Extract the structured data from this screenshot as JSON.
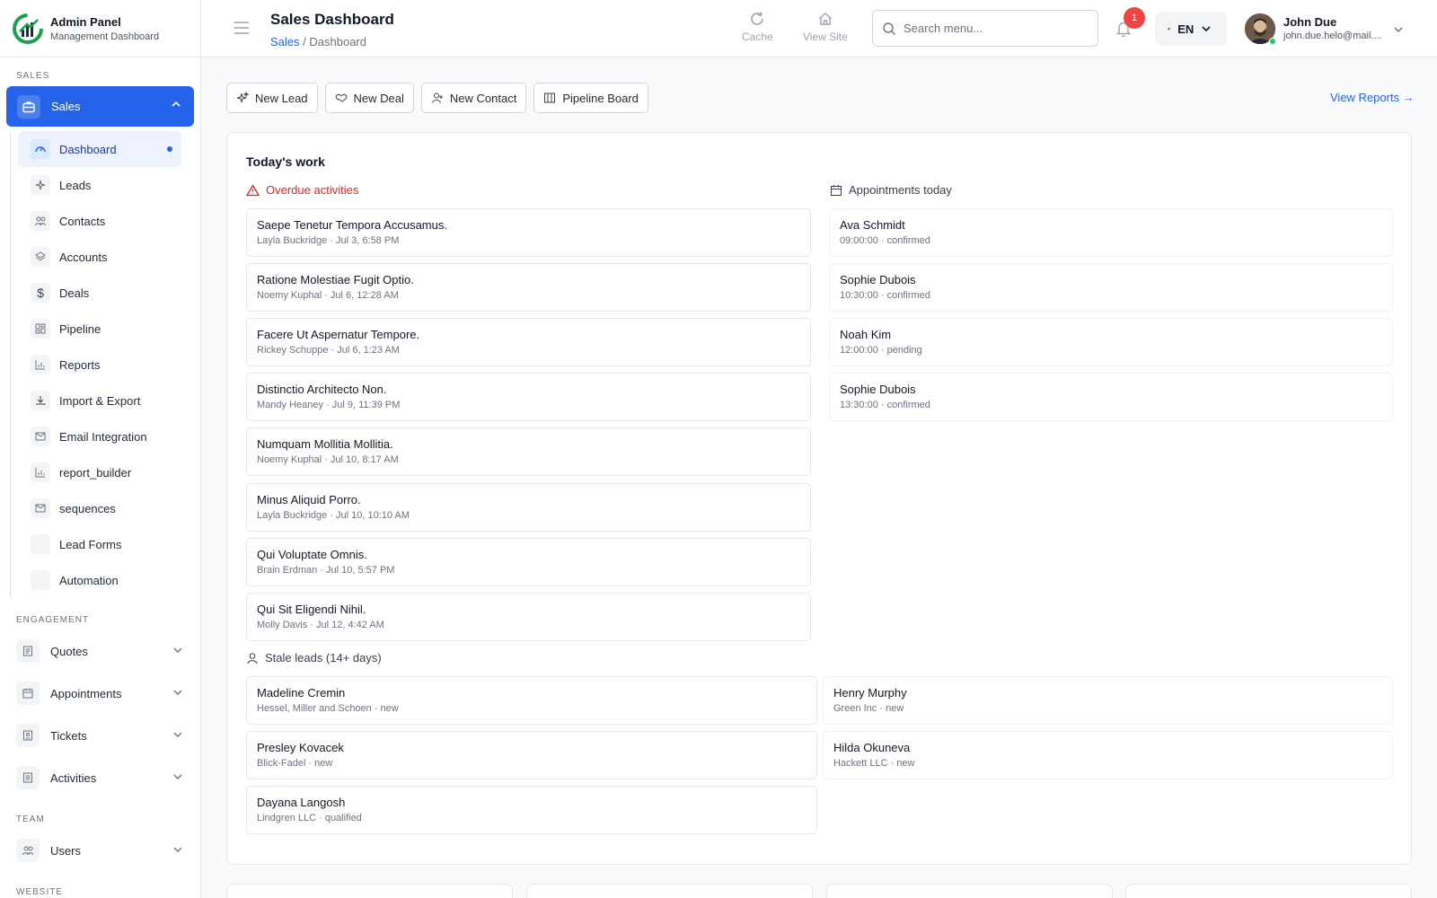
{
  "brand": {
    "title": "Admin Panel",
    "subtitle": "Management Dashboard"
  },
  "sidebar": {
    "section_sales": "SALES",
    "sales_group": {
      "label": "Sales"
    },
    "sub_items": [
      {
        "label": "Dashboard",
        "icon": "gauge-icon"
      },
      {
        "label": "Leads",
        "icon": "sparkles-icon"
      },
      {
        "label": "Contacts",
        "icon": "users-icon"
      },
      {
        "label": "Accounts",
        "icon": "layers-icon"
      },
      {
        "label": "Deals",
        "icon": "dollar-icon"
      },
      {
        "label": "Pipeline",
        "icon": "grid-icon"
      },
      {
        "label": "Reports",
        "icon": "chart-icon"
      },
      {
        "label": "Import & Export",
        "icon": "download-icon"
      },
      {
        "label": "Email Integration",
        "icon": "mail-icon"
      },
      {
        "label": "report_builder",
        "icon": "chart-icon"
      },
      {
        "label": "sequences",
        "icon": "mail-icon"
      },
      {
        "label": "Lead Forms",
        "icon": "blank-icon"
      },
      {
        "label": "Automation",
        "icon": "blank-icon"
      }
    ],
    "section_engagement": "ENGAGEMENT",
    "engagement": [
      {
        "label": "Quotes",
        "icon": "quote-icon"
      },
      {
        "label": "Appointments",
        "icon": "calendar-icon"
      },
      {
        "label": "Tickets",
        "icon": "ticket-icon"
      },
      {
        "label": "Activities",
        "icon": "list-icon"
      }
    ],
    "section_team": "TEAM",
    "team": [
      {
        "label": "Users",
        "icon": "users-icon"
      }
    ],
    "section_website": "WEBSITE"
  },
  "header": {
    "title": "Sales Dashboard",
    "crumb_1": "Sales",
    "crumb_2": "/ Dashboard",
    "cache_label": "Cache",
    "view_site_label": "View Site",
    "search_placeholder": "Search menu...",
    "notif_count": "1",
    "lang": "EN",
    "user_name": "John Due",
    "user_email": "john.due.helo@mail...."
  },
  "quick_actions": [
    {
      "label": "New Lead",
      "icon": "sparkles-icon"
    },
    {
      "label": "New Deal",
      "icon": "handshake-icon"
    },
    {
      "label": "New Contact",
      "icon": "user-plus-icon"
    },
    {
      "label": "Pipeline Board",
      "icon": "columns-icon"
    }
  ],
  "view_reports": "View Reports →",
  "today": {
    "title": "Today's work",
    "overdue_title": "Overdue activities",
    "appointments_title": "Appointments today",
    "stale_title": "Stale leads (14+ days)",
    "overdue": [
      {
        "title": "Saepe Tenetur Tempora Accusamus.",
        "meta": "Layla Buckridge · Jul 3, 6:58 PM"
      },
      {
        "title": "Ratione Molestiae Fugit Optio.",
        "meta": "Noemy Kuphal · Jul 6, 12:28 AM"
      },
      {
        "title": "Facere Ut Aspernatur Tempore.",
        "meta": "Rickey Schuppe · Jul 6, 1:23 AM"
      },
      {
        "title": "Distinctio Architecto Non.",
        "meta": "Mandy Heaney · Jul 9, 11:39 PM"
      },
      {
        "title": "Numquam Mollitia Mollitia.",
        "meta": "Noemy Kuphal · Jul 10, 8:17 AM"
      },
      {
        "title": "Minus Aliquid Porro.",
        "meta": "Layla Buckridge · Jul 10, 10:10 AM"
      },
      {
        "title": "Qui Voluptate Omnis.",
        "meta": "Brain Erdman · Jul 10, 5:57 PM"
      },
      {
        "title": "Qui Sit Eligendi Nihil.",
        "meta": "Molly Davis · Jul 12, 4:42 AM"
      }
    ],
    "appointments": [
      {
        "name": "Ava Schmidt",
        "meta": "09:00:00 · confirmed"
      },
      {
        "name": "Sophie Dubois",
        "meta": "10:30:00 · confirmed"
      },
      {
        "name": "Noah Kim",
        "meta": "12:00:00 · pending"
      },
      {
        "name": "Sophie Dubois",
        "meta": "13:30:00 · confirmed"
      }
    ],
    "stale": [
      {
        "name": "Madeline Cremin",
        "meta": "Hessel, Miller and Schoen · new"
      },
      {
        "name": "Henry Murphy",
        "meta": "Green Inc · new"
      },
      {
        "name": "Presley Kovacek",
        "meta": "Blick-Fadel · new"
      },
      {
        "name": "Hilda Okuneva",
        "meta": "Hackett LLC · new"
      },
      {
        "name": "Dayana Langosh",
        "meta": "Lindgren LLC · qualified"
      }
    ]
  },
  "colors": {
    "accent": "#2563eb",
    "danger": "#dc2626",
    "online": "#22c55e"
  }
}
